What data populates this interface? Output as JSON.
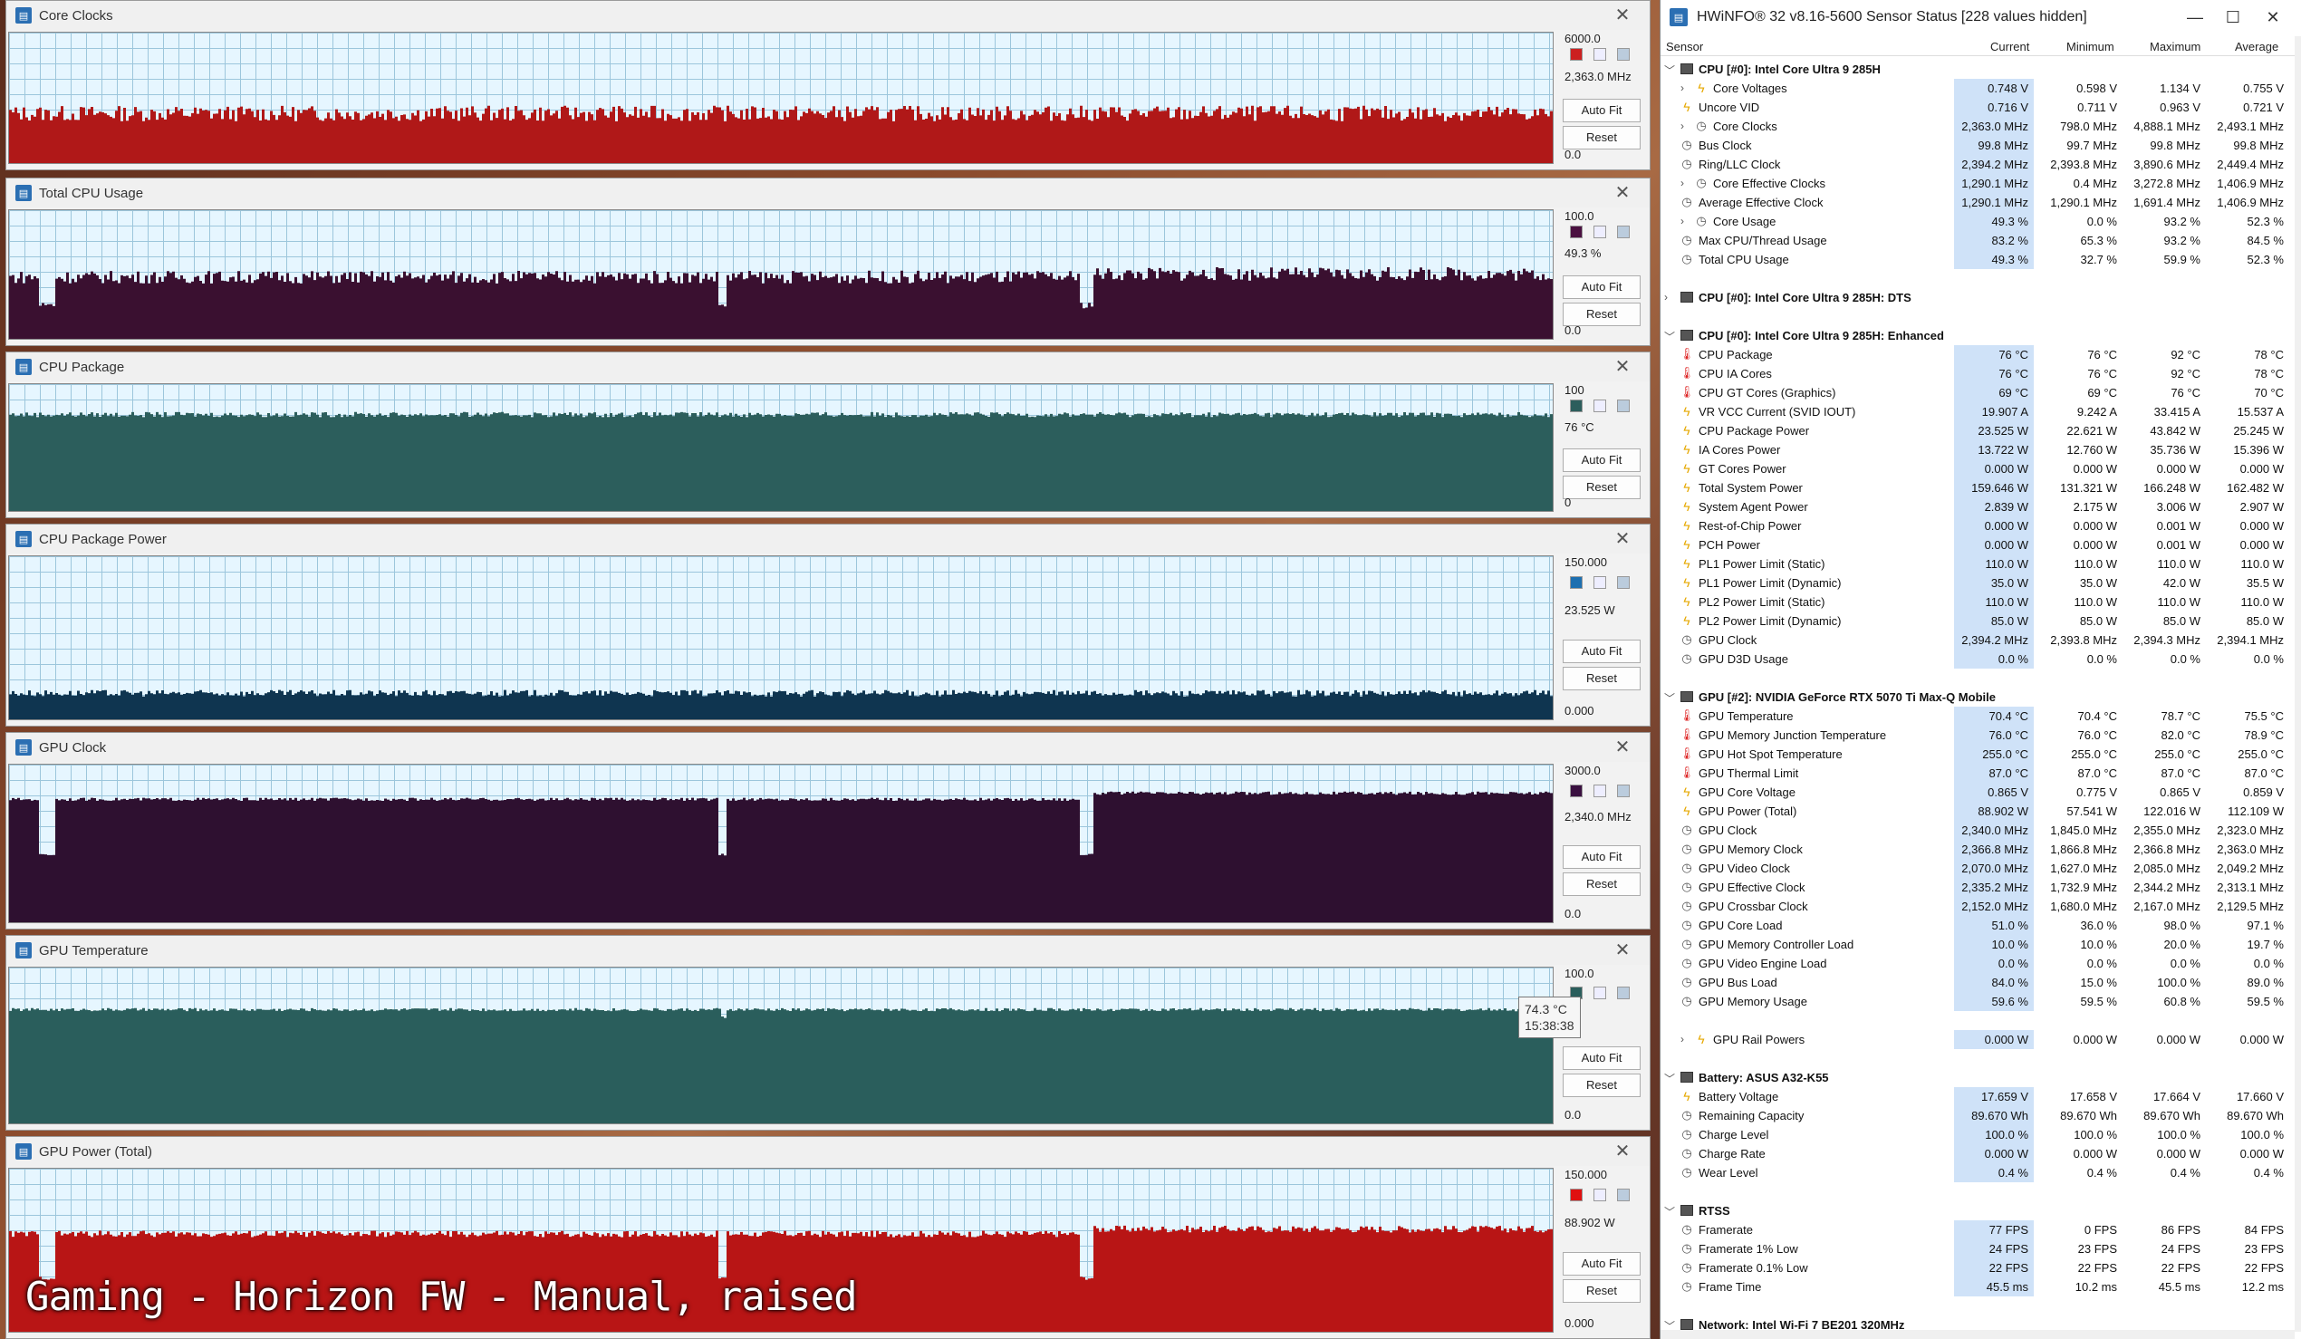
{
  "caption": "Gaming - Horizon FW - Manual, raised",
  "graphs": [
    {
      "title": "Core Clocks",
      "top_label": "6000.0",
      "current": "2,363.0 MHz",
      "bottom_label": "0.0",
      "color": "#b01818",
      "auto_fit": "Auto Fit",
      "reset": "Reset",
      "swatch": "#cc2020",
      "level": 0.38,
      "noise": 0.06
    },
    {
      "title": "Total CPU Usage",
      "top_label": "100.0",
      "current": "49.3 %",
      "bottom_label": "0.0",
      "color": "#3a1030",
      "auto_fit": "Auto Fit",
      "reset": "Reset",
      "swatch": "#4a1040",
      "level": 0.48,
      "noise": 0.05
    },
    {
      "title": "CPU Package",
      "top_label": "100",
      "current": "76 °C",
      "bottom_label": "0",
      "color": "#2c5e5c",
      "auto_fit": "Auto Fit",
      "reset": "Reset",
      "swatch": "#2c5e5c",
      "level": 0.76,
      "noise": 0.02
    },
    {
      "title": "CPU Package Power",
      "top_label": "150.000",
      "current": "23.525 W",
      "bottom_label": "0.000",
      "color": "#0f3550",
      "auto_fit": "Auto Fit",
      "reset": "Reset",
      "swatch": "#1d6fb0",
      "level": 0.16,
      "noise": 0.02
    },
    {
      "title": "GPU Clock",
      "top_label": "3000.0",
      "current": "2,340.0 MHz",
      "bottom_label": "0.0",
      "color": "#2e1030",
      "auto_fit": "Auto Fit",
      "reset": "Reset",
      "swatch": "#3a1040",
      "level": 0.78,
      "noise": 0.01
    },
    {
      "title": "GPU Temperature",
      "top_label": "100.0",
      "current": "°C",
      "bottom_label": "0.0",
      "color": "#2a5e5c",
      "auto_fit": "Auto Fit",
      "reset": "Reset",
      "swatch": "#2a5e5c",
      "level": 0.73,
      "noise": 0.01
    },
    {
      "title": "GPU Power (Total)",
      "top_label": "150.000",
      "current": "88.902 W",
      "bottom_label": "0.000",
      "color": "#b81515",
      "auto_fit": "Auto Fit",
      "reset": "Reset",
      "swatch": "#e01010",
      "level": 0.6,
      "noise": 0.02
    }
  ],
  "tooltip": {
    "value": "74.3 °C",
    "time": "15:38:38"
  },
  "sensor": {
    "title": "HWiNFO® 32 v8.16-5600 Sensor Status [228 values hidden]",
    "columns": {
      "sensor": "Sensor",
      "current": "Current",
      "minimum": "Minimum",
      "maximum": "Maximum",
      "average": "Average"
    },
    "rows": [
      {
        "t": "group",
        "exp": "﹀",
        "name": "CPU [#0]: Intel Core Ultra 9 285H"
      },
      {
        "t": "sub",
        "exp": "›",
        "icon": "bolt",
        "name": "Core Voltages",
        "c": "0.748 V",
        "mn": "0.598 V",
        "mx": "1.134 V",
        "av": "0.755 V"
      },
      {
        "t": "item",
        "icon": "bolt",
        "name": "Uncore VID",
        "c": "0.716 V",
        "mn": "0.711 V",
        "mx": "0.963 V",
        "av": "0.721 V"
      },
      {
        "t": "sub",
        "exp": "›",
        "icon": "clock",
        "name": "Core Clocks",
        "c": "2,363.0 MHz",
        "mn": "798.0 MHz",
        "mx": "4,888.1 MHz",
        "av": "2,493.1 MHz"
      },
      {
        "t": "item",
        "icon": "clock",
        "name": "Bus Clock",
        "c": "99.8 MHz",
        "mn": "99.7 MHz",
        "mx": "99.8 MHz",
        "av": "99.8 MHz"
      },
      {
        "t": "item",
        "icon": "clock",
        "name": "Ring/LLC Clock",
        "c": "2,394.2 MHz",
        "mn": "2,393.8 MHz",
        "mx": "3,890.6 MHz",
        "av": "2,449.4 MHz"
      },
      {
        "t": "sub",
        "exp": "›",
        "icon": "clock",
        "name": "Core Effective Clocks",
        "c": "1,290.1 MHz",
        "mn": "0.4 MHz",
        "mx": "3,272.8 MHz",
        "av": "1,406.9 MHz"
      },
      {
        "t": "item",
        "icon": "clock",
        "name": "Average Effective Clock",
        "c": "1,290.1 MHz",
        "mn": "1,290.1 MHz",
        "mx": "1,691.4 MHz",
        "av": "1,406.9 MHz"
      },
      {
        "t": "sub",
        "exp": "›",
        "icon": "clock",
        "name": "Core Usage",
        "c": "49.3 %",
        "mn": "0.0 %",
        "mx": "93.2 %",
        "av": "52.3 %"
      },
      {
        "t": "item",
        "icon": "clock",
        "name": "Max CPU/Thread Usage",
        "c": "83.2 %",
        "mn": "65.3 %",
        "mx": "93.2 %",
        "av": "84.5 %"
      },
      {
        "t": "item",
        "icon": "clock",
        "name": "Total CPU Usage",
        "c": "49.3 %",
        "mn": "32.7 %",
        "mx": "59.9 %",
        "av": "52.3 %"
      },
      {
        "t": "blank"
      },
      {
        "t": "group",
        "exp": "›",
        "name": "CPU [#0]: Intel Core Ultra 9 285H: DTS"
      },
      {
        "t": "blank"
      },
      {
        "t": "group",
        "exp": "﹀",
        "name": "CPU [#0]: Intel Core Ultra 9 285H: Enhanced"
      },
      {
        "t": "item",
        "icon": "therm",
        "name": "CPU Package",
        "c": "76 °C",
        "mn": "76 °C",
        "mx": "92 °C",
        "av": "78 °C"
      },
      {
        "t": "item",
        "icon": "therm",
        "name": "CPU IA Cores",
        "c": "76 °C",
        "mn": "76 °C",
        "mx": "92 °C",
        "av": "78 °C"
      },
      {
        "t": "item",
        "icon": "therm",
        "name": "CPU GT Cores (Graphics)",
        "c": "69 °C",
        "mn": "69 °C",
        "mx": "76 °C",
        "av": "70 °C"
      },
      {
        "t": "item",
        "icon": "bolt",
        "name": "VR VCC Current (SVID IOUT)",
        "c": "19.907 A",
        "mn": "9.242 A",
        "mx": "33.415 A",
        "av": "15.537 A"
      },
      {
        "t": "item",
        "icon": "bolt",
        "name": "CPU Package Power",
        "c": "23.525 W",
        "mn": "22.621 W",
        "mx": "43.842 W",
        "av": "25.245 W"
      },
      {
        "t": "item",
        "icon": "bolt",
        "name": "IA Cores Power",
        "c": "13.722 W",
        "mn": "12.760 W",
        "mx": "35.736 W",
        "av": "15.396 W"
      },
      {
        "t": "item",
        "icon": "bolt",
        "name": "GT Cores Power",
        "c": "0.000 W",
        "mn": "0.000 W",
        "mx": "0.000 W",
        "av": "0.000 W"
      },
      {
        "t": "item",
        "icon": "bolt",
        "name": "Total System Power",
        "c": "159.646 W",
        "mn": "131.321 W",
        "mx": "166.248 W",
        "av": "162.482 W"
      },
      {
        "t": "item",
        "icon": "bolt",
        "name": "System Agent Power",
        "c": "2.839 W",
        "mn": "2.175 W",
        "mx": "3.006 W",
        "av": "2.907 W"
      },
      {
        "t": "item",
        "icon": "bolt",
        "name": "Rest-of-Chip Power",
        "c": "0.000 W",
        "mn": "0.000 W",
        "mx": "0.001 W",
        "av": "0.000 W"
      },
      {
        "t": "item",
        "icon": "bolt",
        "name": "PCH Power",
        "c": "0.000 W",
        "mn": "0.000 W",
        "mx": "0.001 W",
        "av": "0.000 W"
      },
      {
        "t": "item",
        "icon": "bolt",
        "name": "PL1 Power Limit (Static)",
        "c": "110.0 W",
        "mn": "110.0 W",
        "mx": "110.0 W",
        "av": "110.0 W"
      },
      {
        "t": "item",
        "icon": "bolt",
        "name": "PL1 Power Limit (Dynamic)",
        "c": "35.0 W",
        "mn": "35.0 W",
        "mx": "42.0 W",
        "av": "35.5 W"
      },
      {
        "t": "item",
        "icon": "bolt",
        "name": "PL2 Power Limit (Static)",
        "c": "110.0 W",
        "mn": "110.0 W",
        "mx": "110.0 W",
        "av": "110.0 W"
      },
      {
        "t": "item",
        "icon": "bolt",
        "name": "PL2 Power Limit (Dynamic)",
        "c": "85.0 W",
        "mn": "85.0 W",
        "mx": "85.0 W",
        "av": "85.0 W"
      },
      {
        "t": "item",
        "icon": "clock",
        "name": "GPU Clock",
        "c": "2,394.2 MHz",
        "mn": "2,393.8 MHz",
        "mx": "2,394.3 MHz",
        "av": "2,394.1 MHz"
      },
      {
        "t": "item",
        "icon": "clock",
        "name": "GPU D3D Usage",
        "c": "0.0 %",
        "mn": "0.0 %",
        "mx": "0.0 %",
        "av": "0.0 %"
      },
      {
        "t": "blank"
      },
      {
        "t": "group",
        "exp": "﹀",
        "name": "GPU [#2]: NVIDIA  GeForce RTX 5070 Ti Max-Q Mobile"
      },
      {
        "t": "item",
        "icon": "therm",
        "name": "GPU Temperature",
        "c": "70.4 °C",
        "mn": "70.4 °C",
        "mx": "78.7 °C",
        "av": "75.5 °C"
      },
      {
        "t": "item",
        "icon": "therm",
        "name": "GPU Memory Junction Temperature",
        "c": "76.0 °C",
        "mn": "76.0 °C",
        "mx": "82.0 °C",
        "av": "78.9 °C"
      },
      {
        "t": "item",
        "icon": "therm",
        "name": "GPU Hot Spot Temperature",
        "c": "255.0 °C",
        "mn": "255.0 °C",
        "mx": "255.0 °C",
        "av": "255.0 °C"
      },
      {
        "t": "item",
        "icon": "therm",
        "name": "GPU Thermal Limit",
        "c": "87.0 °C",
        "mn": "87.0 °C",
        "mx": "87.0 °C",
        "av": "87.0 °C"
      },
      {
        "t": "item",
        "icon": "bolt",
        "name": "GPU Core Voltage",
        "c": "0.865 V",
        "mn": "0.775 V",
        "mx": "0.865 V",
        "av": "0.859 V"
      },
      {
        "t": "item",
        "icon": "bolt",
        "name": "GPU Power (Total)",
        "c": "88.902 W",
        "mn": "57.541 W",
        "mx": "122.016 W",
        "av": "112.109 W"
      },
      {
        "t": "item",
        "icon": "clock",
        "name": "GPU Clock",
        "c": "2,340.0 MHz",
        "mn": "1,845.0 MHz",
        "mx": "2,355.0 MHz",
        "av": "2,323.0 MHz"
      },
      {
        "t": "item",
        "icon": "clock",
        "name": "GPU Memory Clock",
        "c": "2,366.8 MHz",
        "mn": "1,866.8 MHz",
        "mx": "2,366.8 MHz",
        "av": "2,363.0 MHz"
      },
      {
        "t": "item",
        "icon": "clock",
        "name": "GPU Video Clock",
        "c": "2,070.0 MHz",
        "mn": "1,627.0 MHz",
        "mx": "2,085.0 MHz",
        "av": "2,049.2 MHz"
      },
      {
        "t": "item",
        "icon": "clock",
        "name": "GPU Effective Clock",
        "c": "2,335.2 MHz",
        "mn": "1,732.9 MHz",
        "mx": "2,344.2 MHz",
        "av": "2,313.1 MHz"
      },
      {
        "t": "item",
        "icon": "clock",
        "name": "GPU Crossbar Clock",
        "c": "2,152.0 MHz",
        "mn": "1,680.0 MHz",
        "mx": "2,167.0 MHz",
        "av": "2,129.5 MHz"
      },
      {
        "t": "item",
        "icon": "clock",
        "name": "GPU Core Load",
        "c": "51.0 %",
        "mn": "36.0 %",
        "mx": "98.0 %",
        "av": "97.1 %"
      },
      {
        "t": "item",
        "icon": "clock",
        "name": "GPU Memory Controller Load",
        "c": "10.0 %",
        "mn": "10.0 %",
        "mx": "20.0 %",
        "av": "19.7 %"
      },
      {
        "t": "item",
        "icon": "clock",
        "name": "GPU Video Engine Load",
        "c": "0.0 %",
        "mn": "0.0 %",
        "mx": "0.0 %",
        "av": "0.0 %"
      },
      {
        "t": "item",
        "icon": "clock",
        "name": "GPU Bus Load",
        "c": "84.0 %",
        "mn": "15.0 %",
        "mx": "100.0 %",
        "av": "89.0 %"
      },
      {
        "t": "item",
        "icon": "clock",
        "name": "GPU Memory Usage",
        "c": "59.6 %",
        "mn": "59.5 %",
        "mx": "60.8 %",
        "av": "59.5 %"
      },
      {
        "t": "blank"
      },
      {
        "t": "sub",
        "exp": "›",
        "icon": "bolt",
        "name": "GPU Rail Powers",
        "c": "0.000 W",
        "mn": "0.000 W",
        "mx": "0.000 W",
        "av": "0.000 W"
      },
      {
        "t": "blank"
      },
      {
        "t": "group",
        "exp": "﹀",
        "name": "Battery: ASUS  A32-K55"
      },
      {
        "t": "item",
        "icon": "bolt",
        "name": "Battery Voltage",
        "c": "17.659 V",
        "mn": "17.658 V",
        "mx": "17.664 V",
        "av": "17.660 V"
      },
      {
        "t": "item",
        "icon": "clock",
        "name": "Remaining Capacity",
        "c": "89.670 Wh",
        "mn": "89.670 Wh",
        "mx": "89.670 Wh",
        "av": "89.670 Wh"
      },
      {
        "t": "item",
        "icon": "clock",
        "name": "Charge Level",
        "c": "100.0 %",
        "mn": "100.0 %",
        "mx": "100.0 %",
        "av": "100.0 %"
      },
      {
        "t": "item",
        "icon": "clock",
        "name": "Charge Rate",
        "c": "0.000 W",
        "mn": "0.000 W",
        "mx": "0.000 W",
        "av": "0.000 W"
      },
      {
        "t": "item",
        "icon": "clock",
        "name": "Wear Level",
        "c": "0.4 %",
        "mn": "0.4 %",
        "mx": "0.4 %",
        "av": "0.4 %"
      },
      {
        "t": "blank"
      },
      {
        "t": "group",
        "exp": "﹀",
        "name": "RTSS"
      },
      {
        "t": "item",
        "icon": "clock",
        "name": "Framerate",
        "c": "77 FPS",
        "mn": "0 FPS",
        "mx": "86 FPS",
        "av": "84 FPS"
      },
      {
        "t": "item",
        "icon": "clock",
        "name": "Framerate 1% Low",
        "c": "24 FPS",
        "mn": "23 FPS",
        "mx": "24 FPS",
        "av": "23 FPS"
      },
      {
        "t": "item",
        "icon": "clock",
        "name": "Framerate 0.1% Low",
        "c": "22 FPS",
        "mn": "22 FPS",
        "mx": "22 FPS",
        "av": "22 FPS"
      },
      {
        "t": "item",
        "icon": "clock",
        "name": "Frame Time",
        "c": "45.5 ms",
        "mn": "10.2 ms",
        "mx": "45.5 ms",
        "av": "12.2 ms"
      },
      {
        "t": "blank"
      },
      {
        "t": "group",
        "exp": "﹀",
        "name": "Network: Intel Wi-Fi 7 BE201 320MHz"
      }
    ]
  }
}
